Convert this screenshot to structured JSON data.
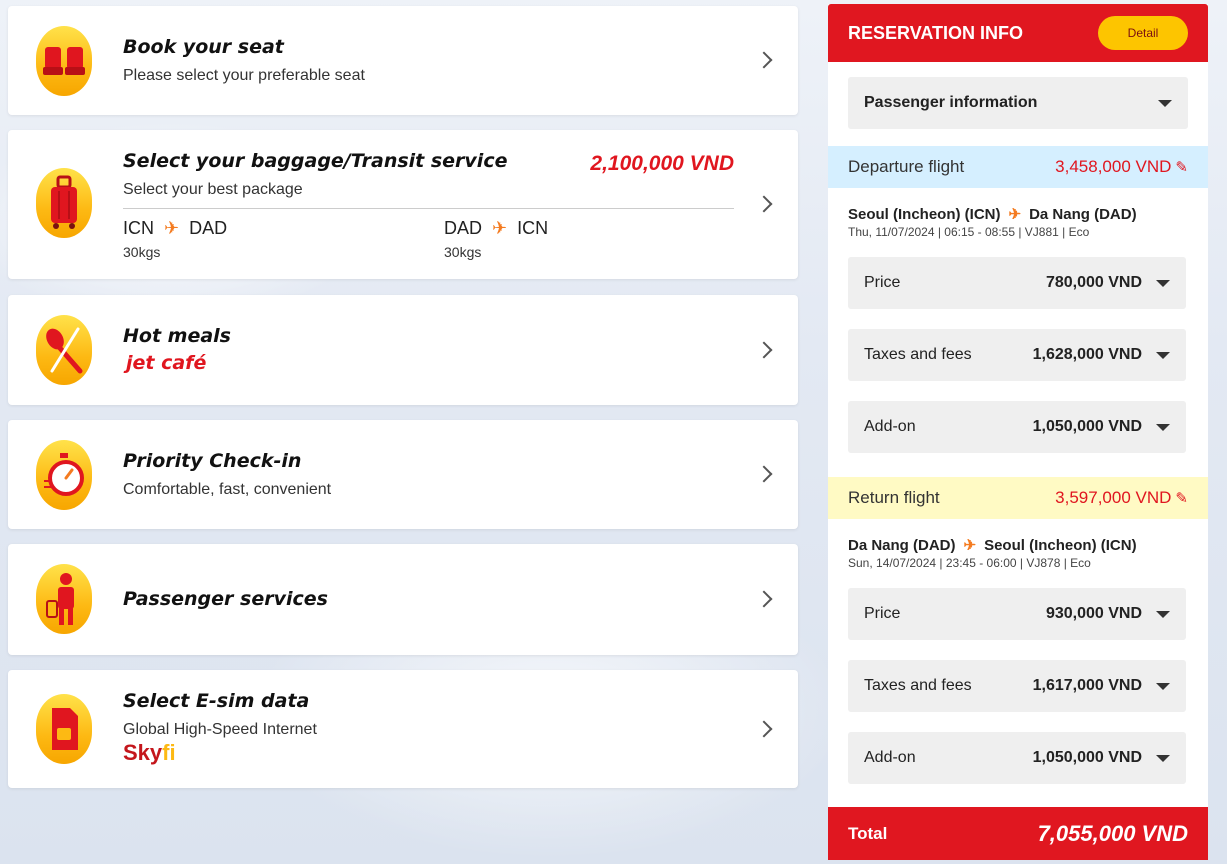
{
  "colors": {
    "brand_red": "#e01720",
    "brand_yellow": "#fdc500",
    "departure_band": "#d5efff",
    "return_band": "#fffac4"
  },
  "services": [
    {
      "icon": "seat-icon",
      "title": "Book your seat",
      "subtitle": "Please select your preferable seat"
    },
    {
      "icon": "luggage-icon",
      "title": "Select your baggage/Transit service",
      "subtitle": "Select your best package",
      "price": "2,100,000 VND",
      "legs": [
        {
          "from": "ICN",
          "to": "DAD",
          "weight": "30kgs"
        },
        {
          "from": "DAD",
          "to": "ICN",
          "weight": "30kgs"
        }
      ]
    },
    {
      "icon": "spoon-fork-icon",
      "title": "Hot meals",
      "brand": "jet café"
    },
    {
      "icon": "stopwatch-icon",
      "title": "Priority Check-in",
      "subtitle": "Comfortable, fast, convenient"
    },
    {
      "icon": "passenger-icon",
      "title": "Passenger services"
    },
    {
      "icon": "sim-card-icon",
      "title": "Select E-sim data",
      "subtitle": "Global High-Speed Internet",
      "brand_a": "Sky",
      "brand_b": "fi"
    }
  ],
  "reservation": {
    "title": "RESERVATION INFO",
    "detail_label": "Detail",
    "passenger_label": "Passenger information",
    "departure": {
      "label": "Departure flight",
      "amount": "3,458,000 VND",
      "from": "Seoul (Incheon) (ICN)",
      "to": "Da Nang (DAD)",
      "meta": "Thu, 11/07/2024 | 06:15 - 08:55 | VJ881 | Eco",
      "rows": [
        {
          "label": "Price",
          "value": "780,000 VND"
        },
        {
          "label": "Taxes and fees",
          "value": "1,628,000 VND"
        },
        {
          "label": "Add-on",
          "value": "1,050,000 VND"
        }
      ]
    },
    "return": {
      "label": "Return flight",
      "amount": "3,597,000 VND",
      "from": "Da Nang (DAD)",
      "to": "Seoul (Incheon) (ICN)",
      "meta": "Sun, 14/07/2024 | 23:45 - 06:00 | VJ878 | Eco",
      "rows": [
        {
          "label": "Price",
          "value": "930,000 VND"
        },
        {
          "label": "Taxes and fees",
          "value": "1,617,000 VND"
        },
        {
          "label": "Add-on",
          "value": "1,050,000 VND"
        }
      ]
    },
    "total_label": "Total",
    "total_value": "7,055,000 VND"
  }
}
